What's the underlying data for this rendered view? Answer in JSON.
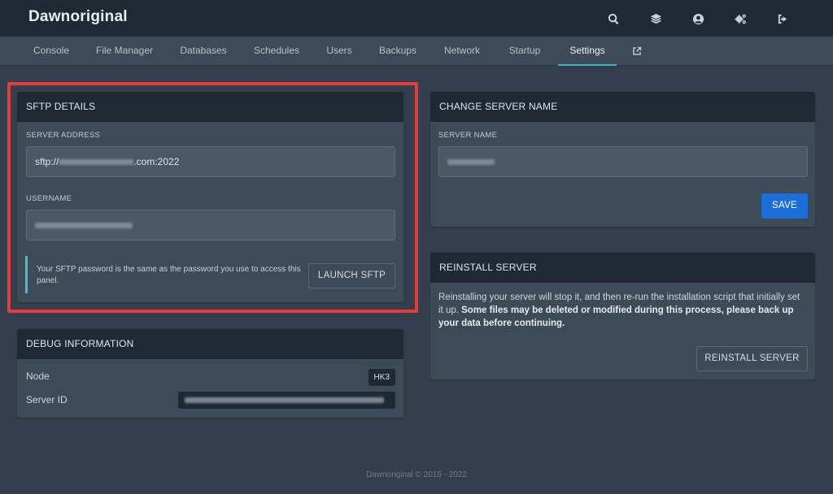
{
  "app": {
    "brand": "Dawnoriginal"
  },
  "top_icons": [
    "search-icon",
    "layers-icon",
    "user-circle-icon",
    "cogs-icon",
    "sign-out-icon"
  ],
  "nav": {
    "items": [
      "Console",
      "File Manager",
      "Databases",
      "Schedules",
      "Users",
      "Backups",
      "Network",
      "Startup",
      "Settings"
    ],
    "active": "Settings",
    "external_icon": "external-link-icon"
  },
  "sftp": {
    "title": "SFTP DETAILS",
    "address_label": "SERVER ADDRESS",
    "address_prefix": "sftp://",
    "address_suffix": ".com:2022",
    "username_label": "USERNAME",
    "notice": "Your SFTP password is the same as the password you use to access this panel.",
    "launch_label": "LAUNCH SFTP"
  },
  "debug": {
    "title": "DEBUG INFORMATION",
    "node_label": "Node",
    "node_value": "HK3",
    "server_id_label": "Server ID"
  },
  "rename": {
    "title": "CHANGE SERVER NAME",
    "name_label": "SERVER NAME",
    "save_label": "SAVE"
  },
  "reinstall": {
    "title": "REINSTALL SERVER",
    "text_plain": "Reinstalling your server will stop it, and then re-run the installation script that initially set it up.",
    "text_bold": "Some files may be deleted or modified during this process, please back up your data before continuing.",
    "button_label": "REINSTALL SERVER"
  },
  "footer": {
    "text": "Dawnoriginal © 2015 - 2022"
  },
  "colors": {
    "accent": "#3fb4c0",
    "primary": "#1c6fd9",
    "highlight": "#e8393d"
  }
}
